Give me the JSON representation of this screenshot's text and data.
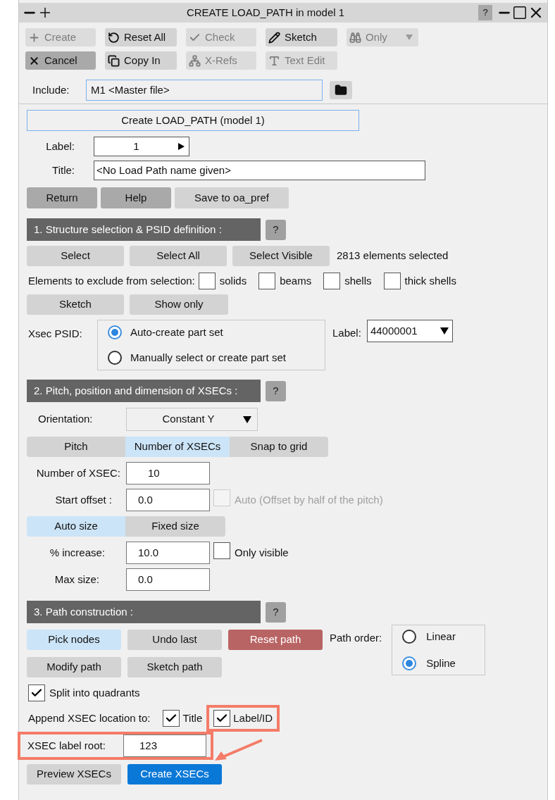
{
  "window": {
    "title": "CREATE LOAD_PATH in model 1",
    "help": "?"
  },
  "toolbar": [
    {
      "label": "Create",
      "disabled": true
    },
    {
      "label": "Reset All",
      "disabled": false
    },
    {
      "label": "Check",
      "disabled": true
    },
    {
      "label": "Sketch",
      "disabled": false
    },
    {
      "label": "Only",
      "disabled": true
    },
    {
      "label": "Cancel",
      "disabled": false
    },
    {
      "label": "Copy In",
      "disabled": false
    },
    {
      "label": "X-Refs",
      "disabled": true
    },
    {
      "label": "Text Edit",
      "disabled": true
    }
  ],
  "include": {
    "label": "Include:",
    "value": "M1  <Master file>"
  },
  "heading_button": "Create LOAD_PATH (model 1)",
  "label_field": {
    "label": "Label:",
    "value": "1"
  },
  "title_field": {
    "label": "Title:",
    "value": "<No Load Path name given>"
  },
  "nav_buttons": [
    {
      "label": "Return",
      "kind": "dark"
    },
    {
      "label": "Help",
      "kind": "dark"
    },
    {
      "label": "Save to oa_pref",
      "kind": "normal"
    }
  ],
  "section1": {
    "title": "1. Structure selection & PSID definition :",
    "help": "?",
    "select_buttons": [
      "Select",
      "Select All",
      "Select Visible"
    ],
    "selection_count": "2813 elements selected",
    "exclude_label": "Elements to exclude from selection:",
    "exclude": [
      {
        "label": "solids",
        "checked": false
      },
      {
        "label": "beams",
        "checked": false
      },
      {
        "label": "shells",
        "checked": false
      },
      {
        "label": "thick shells",
        "checked": false
      }
    ],
    "action_buttons": [
      "Sketch",
      "Show only"
    ],
    "psid": {
      "label": "Xsec PSID:",
      "options": [
        {
          "label": "Auto-create part set",
          "selected": true
        },
        {
          "label": "Manually select or create part set",
          "selected": false
        }
      ],
      "set_label": "Label:",
      "set_value": "44000001"
    }
  },
  "section2": {
    "title": "2. Pitch, position and dimension of XSECs :",
    "help": "?",
    "orientation": {
      "label": "Orientation:",
      "value": "Constant Y"
    },
    "mode_tabs": [
      {
        "label": "Pitch",
        "selected": false
      },
      {
        "label": "Number of XSECs",
        "selected": true
      },
      {
        "label": "Snap to grid",
        "selected": false
      }
    ],
    "number": {
      "label": "Number of XSEC:",
      "value": "10"
    },
    "start_offset": {
      "label": "Start offset :",
      "value": "0.0",
      "auto": {
        "label": "Auto (Offset by half of the pitch)",
        "checked": false,
        "disabled": true
      }
    },
    "size_tabs": [
      {
        "label": "Auto size",
        "selected": true
      },
      {
        "label": "Fixed size",
        "selected": false
      }
    ],
    "increase": {
      "label": "% increase:",
      "value": "10.0",
      "only_visible": {
        "label": "Only visible",
        "checked": false,
        "disabled": false
      }
    },
    "max_size": {
      "label": "Max size:",
      "value": "0.0"
    }
  },
  "section3": {
    "title": "3. Path construction :",
    "help": "?",
    "path_buttons": [
      {
        "label": "Pick nodes",
        "kind": "active"
      },
      {
        "label": "Undo last",
        "kind": "normal"
      },
      {
        "label": "Reset path",
        "kind": "danger"
      },
      {
        "label": "Modify path",
        "kind": "normal"
      },
      {
        "label": "Sketch path",
        "kind": "normal"
      }
    ],
    "path_order": {
      "label": "Path order:",
      "options": [
        {
          "label": "Linear",
          "selected": false
        },
        {
          "label": "Spline",
          "selected": true
        }
      ]
    },
    "split": {
      "label": "Split into quadrants",
      "checked": true
    },
    "append": {
      "label": "Append XSEC location to:",
      "options": [
        {
          "label": "Title",
          "checked": true,
          "highlighted": false
        },
        {
          "label": "Label/ID",
          "checked": true,
          "highlighted": true
        }
      ]
    },
    "label_root": {
      "label": "XSEC label root:",
      "value": "123",
      "highlighted": true
    },
    "final_buttons": [
      {
        "label": "Preview XSECs",
        "kind": "normal"
      },
      {
        "label": "Create XSECs",
        "kind": "primary"
      }
    ]
  }
}
